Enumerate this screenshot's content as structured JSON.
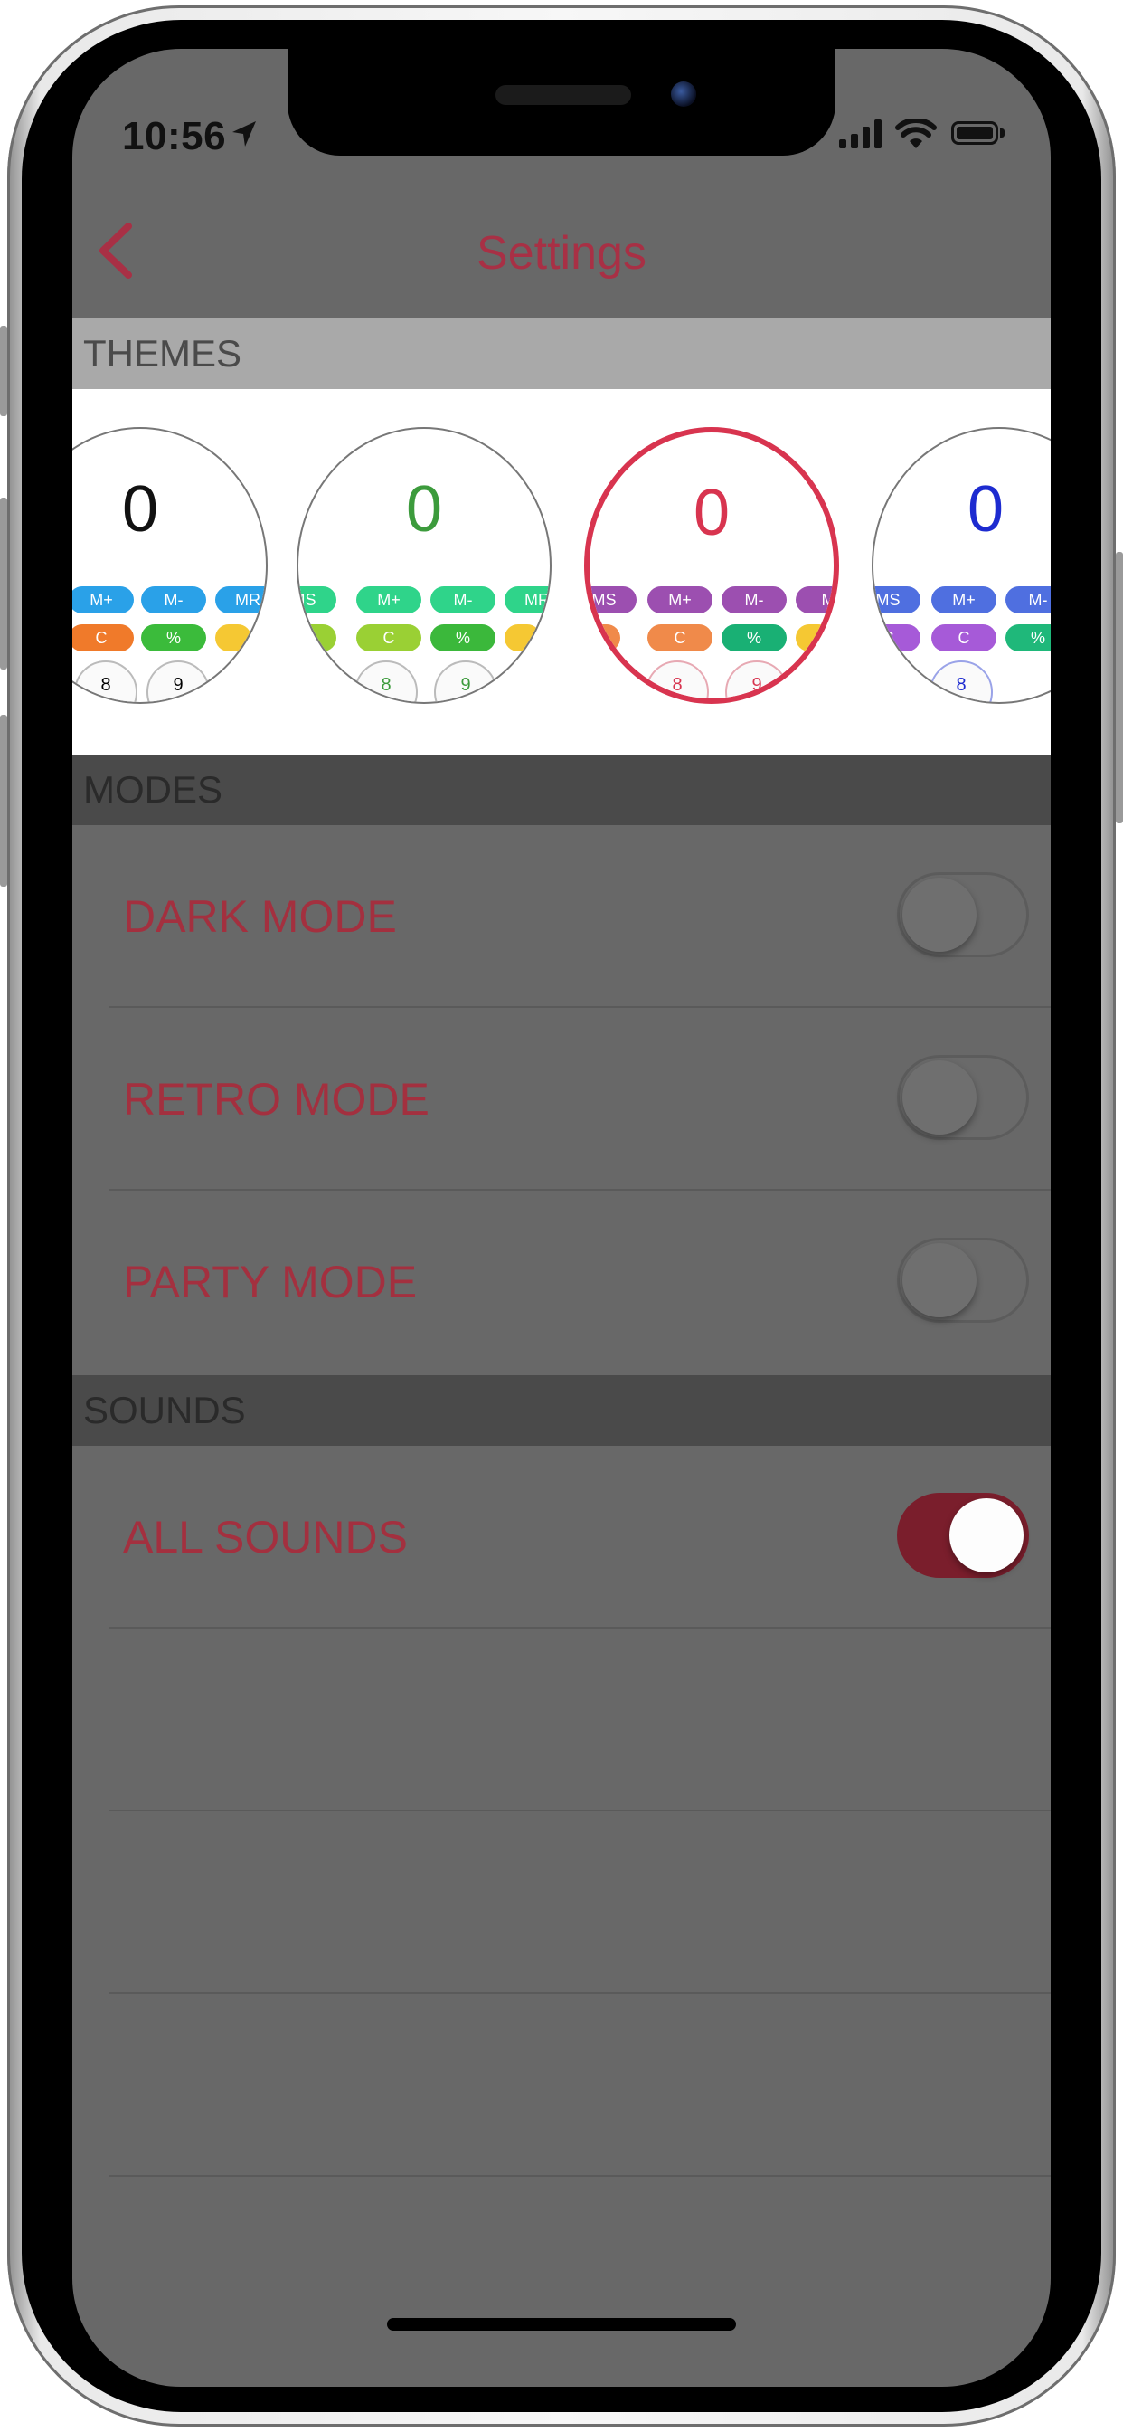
{
  "status_bar": {
    "time": "10:56"
  },
  "nav": {
    "title": "Settings"
  },
  "sections": {
    "themes": "THEMES",
    "modes": "MODES",
    "sounds": "SOUNDS"
  },
  "themes": [
    {
      "display": "0",
      "display_color": "#111111",
      "pills_row1": [
        "M+",
        "M-",
        "MR"
      ],
      "pills_row1_colors": [
        "#2aa1e8",
        "#2aa1e8",
        "#2aa1e8"
      ],
      "pills_row2": [
        "C",
        "%"
      ],
      "pills_row2_colors": [
        "#f07a2a",
        "#3bbb3b"
      ],
      "keys": [
        "8",
        "9"
      ]
    },
    {
      "display": "0",
      "display_color": "#3c9b3c",
      "pills_row1": [
        "MS",
        "M+",
        "M-",
        "MR"
      ],
      "pills_row1_colors": [
        "#2fd48a",
        "#2fd48a",
        "#2fd48a",
        "#2fd48a"
      ],
      "pills_row2": [
        "C",
        "C",
        "%"
      ],
      "pills_row2_colors": [
        "#9ad034",
        "#9ad034",
        "#3bb83b"
      ],
      "keys": [
        "8",
        "9"
      ]
    },
    {
      "display": "0",
      "display_color": "#d8344f",
      "pills_row1": [
        "MS",
        "M+",
        "M-",
        "M"
      ],
      "pills_row1_colors": [
        "#9c4fb0",
        "#9c4fb0",
        "#9c4fb0",
        "#9c4fb0"
      ],
      "pills_row2": [
        "C",
        "%"
      ],
      "pills_row2_colors": [
        "#f08a4a",
        "#19b074"
      ],
      "keys": [
        "8",
        "9"
      ],
      "selected": true
    },
    {
      "display": "0",
      "display_color": "#1d2bd0",
      "pills_row1": [
        "MS",
        "M+",
        "M-"
      ],
      "pills_row1_colors": [
        "#4f6fe0",
        "#4f6fe0",
        "#4f6fe0"
      ],
      "pills_row2": [
        "C",
        "C",
        "%"
      ],
      "pills_row2_colors": [
        "#a65ad8",
        "#a65ad8",
        "#1fb87a"
      ],
      "keys": [
        "8"
      ]
    }
  ],
  "modes": [
    {
      "label": "DARK MODE",
      "on": false
    },
    {
      "label": "RETRO MODE",
      "on": false
    },
    {
      "label": "PARTY MODE",
      "on": false
    }
  ],
  "sounds": [
    {
      "label": "ALL SOUNDS",
      "on": true
    }
  ],
  "colors": {
    "accent": "#a83045",
    "toggle_on": "#7a1e2c",
    "overlay": "#686868"
  }
}
